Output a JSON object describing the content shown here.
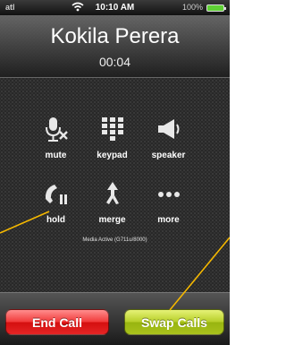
{
  "status_bar": {
    "time": "10:10 AM",
    "battery_percent": "100%",
    "signal_label": "atl",
    "wifi_icon": "wifi-icon",
    "battery_icon": "battery-icon",
    "battery_level": 1.0,
    "battery_color": "#5fd035"
  },
  "call": {
    "caller_name": "Kokila Perera",
    "duration": "00:04",
    "media_status": "Media Active (G711u/8000)"
  },
  "controls": [
    {
      "label": "mute",
      "icon": "microphone-muted-icon"
    },
    {
      "label": "keypad",
      "icon": "keypad-icon"
    },
    {
      "label": "speaker",
      "icon": "speaker-icon"
    },
    {
      "label": "hold",
      "icon": "hold-handset-icon"
    },
    {
      "label": "merge",
      "icon": "merge-arrows-icon"
    },
    {
      "label": "more",
      "icon": "more-dots-icon"
    }
  ],
  "actions": {
    "end_call": "End Call",
    "swap_calls": "Swap Calls"
  },
  "colors": {
    "end_call": "#e52525",
    "swap_calls": "#a9c21d",
    "callout_line": "#f5b800"
  }
}
